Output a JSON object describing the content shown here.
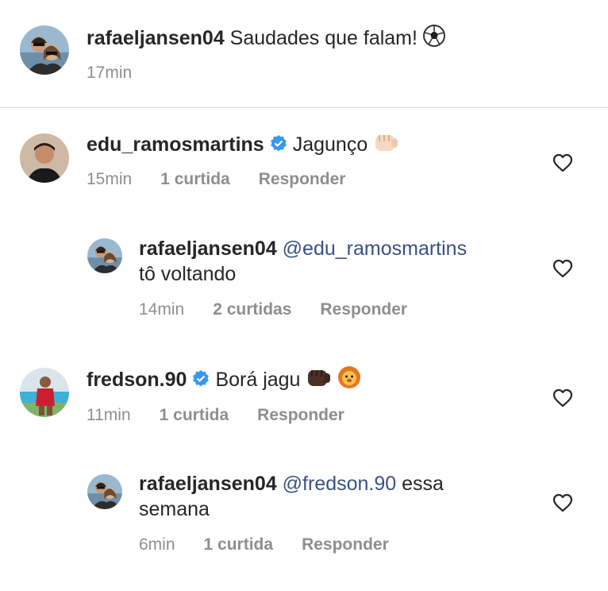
{
  "caption": {
    "username": "rafaeljansen04",
    "text": "Saudades que falam!",
    "emoji": "soccer-ball-icon",
    "time": "17min"
  },
  "comments": [
    {
      "username": "edu_ramosmartins",
      "verified": true,
      "text": "Jagunço",
      "emoji": "fist-icon",
      "time": "15min",
      "likes": "1 curtida",
      "reply_label": "Responder"
    },
    {
      "username": "rafaeljansen04",
      "mention": "@edu_ramosmartins",
      "text": "tô voltando",
      "time": "14min",
      "likes": "2 curtidas",
      "reply_label": "Responder"
    },
    {
      "username": "fredson.90",
      "verified": true,
      "text": "Borá jagu",
      "emoji": "fist-dark-and-lion-icon",
      "time": "11min",
      "likes": "1 curtida",
      "reply_label": "Responder"
    },
    {
      "username": "rafaeljansen04",
      "mention": "@fredson.90",
      "text": "essa",
      "text2": "semana",
      "time": "6min",
      "likes": "1 curtida",
      "reply_label": "Responder"
    }
  ],
  "colors": {
    "text": "#262626",
    "meta": "#8e8e8e",
    "mention": "#385185",
    "verified": "#3897f0"
  }
}
